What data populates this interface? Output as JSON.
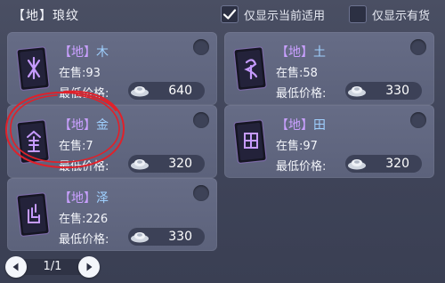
{
  "header": {
    "title_tag": "【地】",
    "title": "琅纹",
    "filter_current": {
      "label": "仅显示当前适用",
      "checked": true
    },
    "filter_stock": {
      "label": "仅显示有货",
      "checked": false
    }
  },
  "items": [
    {
      "tag": "【地】",
      "name": "木",
      "stock_label": "在售:",
      "stock": "93",
      "price_label": "最低价格:",
      "price": "640",
      "glyph": "wood-rune-icon"
    },
    {
      "tag": "【地】",
      "name": "土",
      "stock_label": "在售:",
      "stock": "58",
      "price_label": "最低价格:",
      "price": "330",
      "glyph": "earth-rune-icon"
    },
    {
      "tag": "【地】",
      "name": "金",
      "stock_label": "在售:",
      "stock": "7",
      "price_label": "最低价格:",
      "price": "320",
      "glyph": "metal-rune-icon"
    },
    {
      "tag": "【地】",
      "name": "田",
      "stock_label": "在售:",
      "stock": "97",
      "price_label": "最低价格:",
      "price": "320",
      "glyph": "field-rune-icon"
    },
    {
      "tag": "【地】",
      "name": "泽",
      "stock_label": "在售:",
      "stock": "226",
      "price_label": "最低价格:",
      "price": "330",
      "glyph": "marsh-rune-icon"
    }
  ],
  "pager": {
    "page": "1/1"
  },
  "colors": {
    "name": "#9fd0ff",
    "tag": "#c9a0ff",
    "annotation": "#e0212a"
  }
}
